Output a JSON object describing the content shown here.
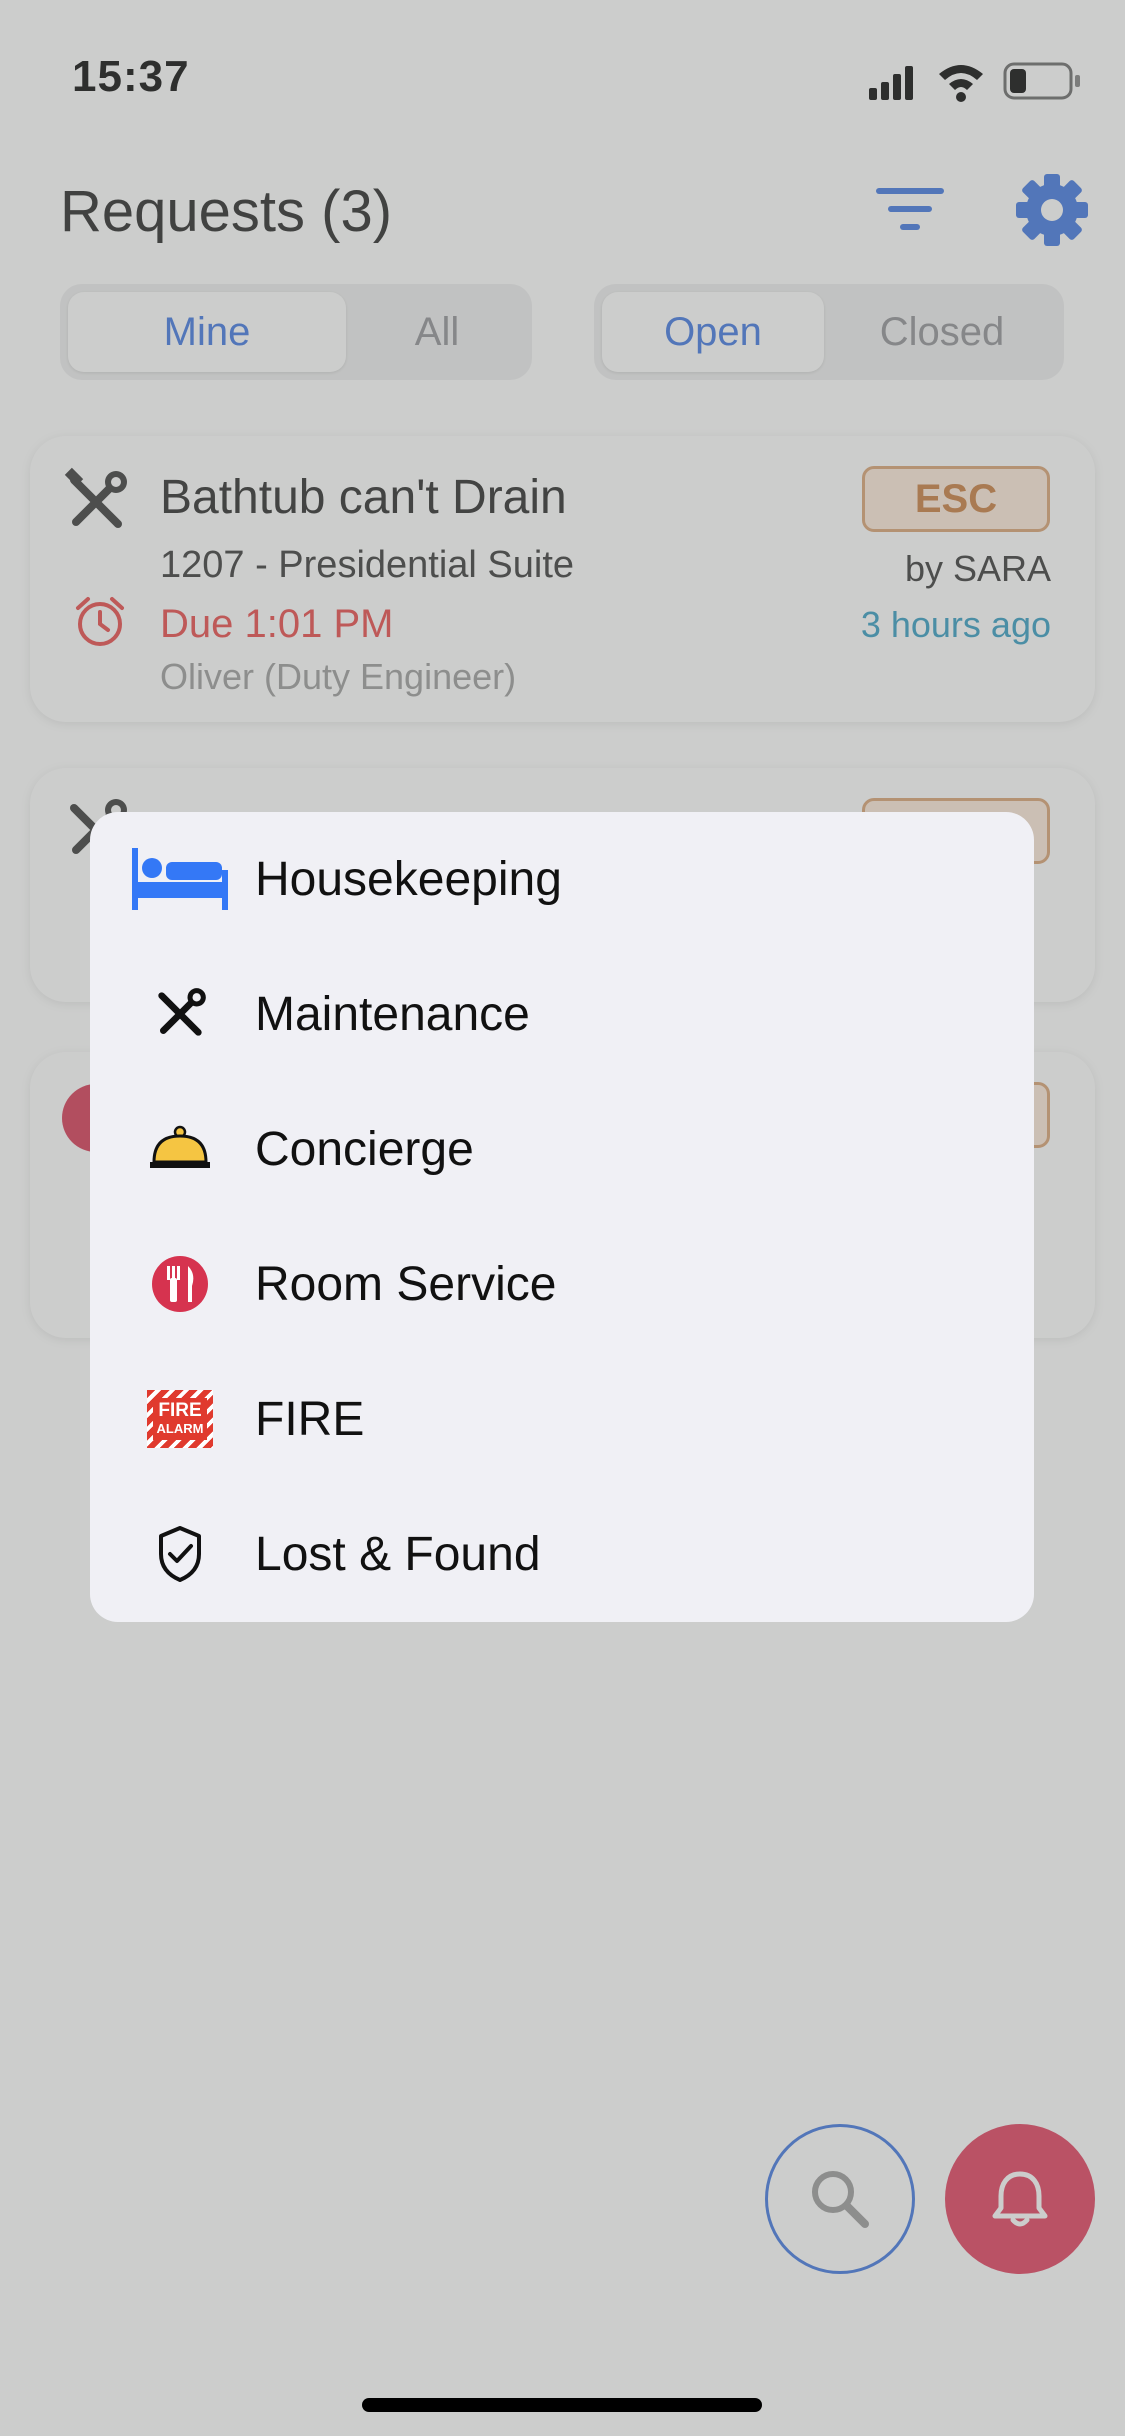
{
  "status_bar": {
    "time": "15:37"
  },
  "header": {
    "title": "Requests (3)"
  },
  "filters": {
    "owner": {
      "mine": "Mine",
      "all": "All"
    },
    "state": {
      "open": "Open",
      "closed": "Closed"
    }
  },
  "cards": [
    {
      "title": "Bathtub can't Drain",
      "location": "1207 - Presidential Suite",
      "due": "Due 1:01 PM",
      "assignee": "Oliver (Duty Engineer)",
      "badge": "ESC",
      "by": "by SARA",
      "ago": "3 hours ago"
    }
  ],
  "menu": {
    "items": [
      {
        "label": "Housekeeping",
        "icon": "bed-icon"
      },
      {
        "label": "Maintenance",
        "icon": "tools-icon"
      },
      {
        "label": "Concierge",
        "icon": "service-bell-icon"
      },
      {
        "label": "Room Service",
        "icon": "fork-knife-icon"
      },
      {
        "label": "FIRE",
        "icon": "fire-alarm-icon"
      },
      {
        "label": "Lost & Found",
        "icon": "shield-check-icon"
      }
    ],
    "fire_icon_text": {
      "line1": "FIRE",
      "line2": "ALARM"
    }
  },
  "colors": {
    "accent": "#3b73e0",
    "danger": "#e84545",
    "fab_alert": "#e3395a",
    "badge_border": "#d8a070"
  }
}
